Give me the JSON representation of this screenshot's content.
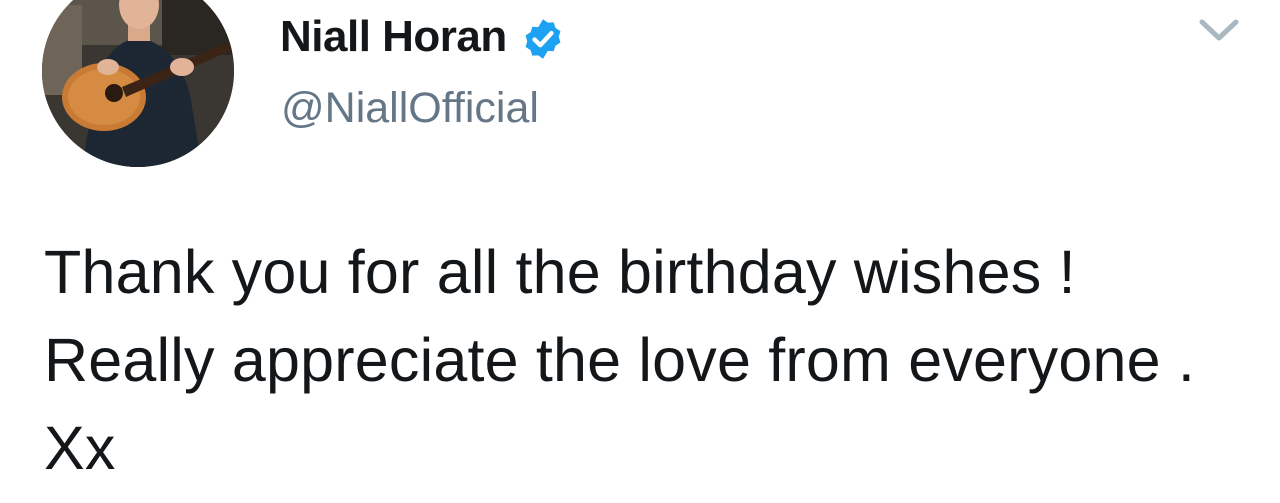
{
  "author": {
    "display_name": "Niall Horan",
    "handle": "@NiallOfficial",
    "verified": true,
    "avatar_icon": "profile-photo-guitar"
  },
  "tweet": {
    "text": "Thank you for all the birthday wishes ! Really appreciate the love from everyone . Xx"
  },
  "menu": {
    "icon": "chevron-down-icon"
  },
  "colors": {
    "text": "#14171a",
    "secondary": "#657786",
    "verified_blue": "#1da1f2",
    "chevron": "#aab8c2"
  }
}
